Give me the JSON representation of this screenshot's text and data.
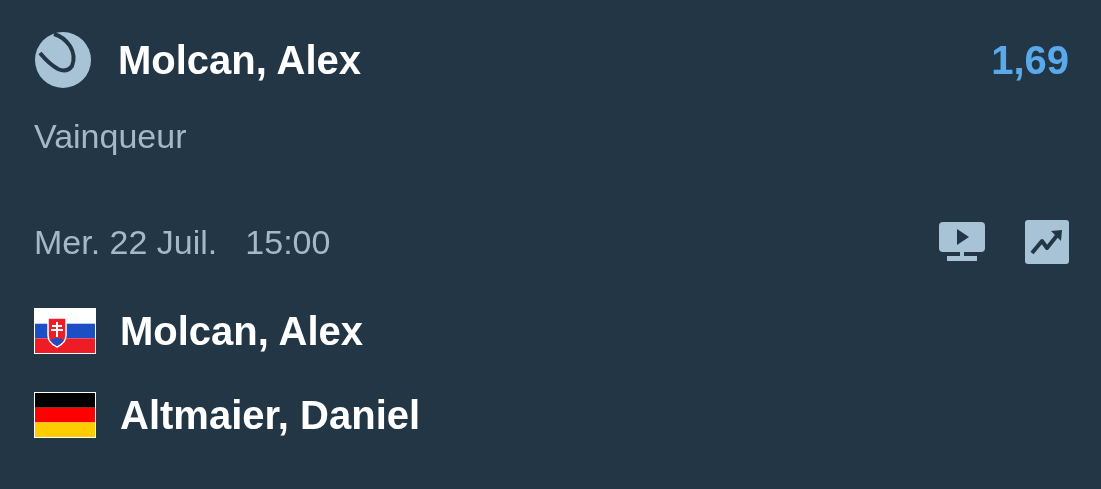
{
  "selection": {
    "name": "Molcan, Alex",
    "odds": "1,69",
    "market": "Vainqueur"
  },
  "match": {
    "date": "Mer. 22 Juil.",
    "time": "15:00"
  },
  "players": [
    {
      "name": "Molcan, Alex",
      "kind": "slovakia"
    },
    {
      "name": "Altmaier, Daniel",
      "kind": "germany"
    }
  ]
}
